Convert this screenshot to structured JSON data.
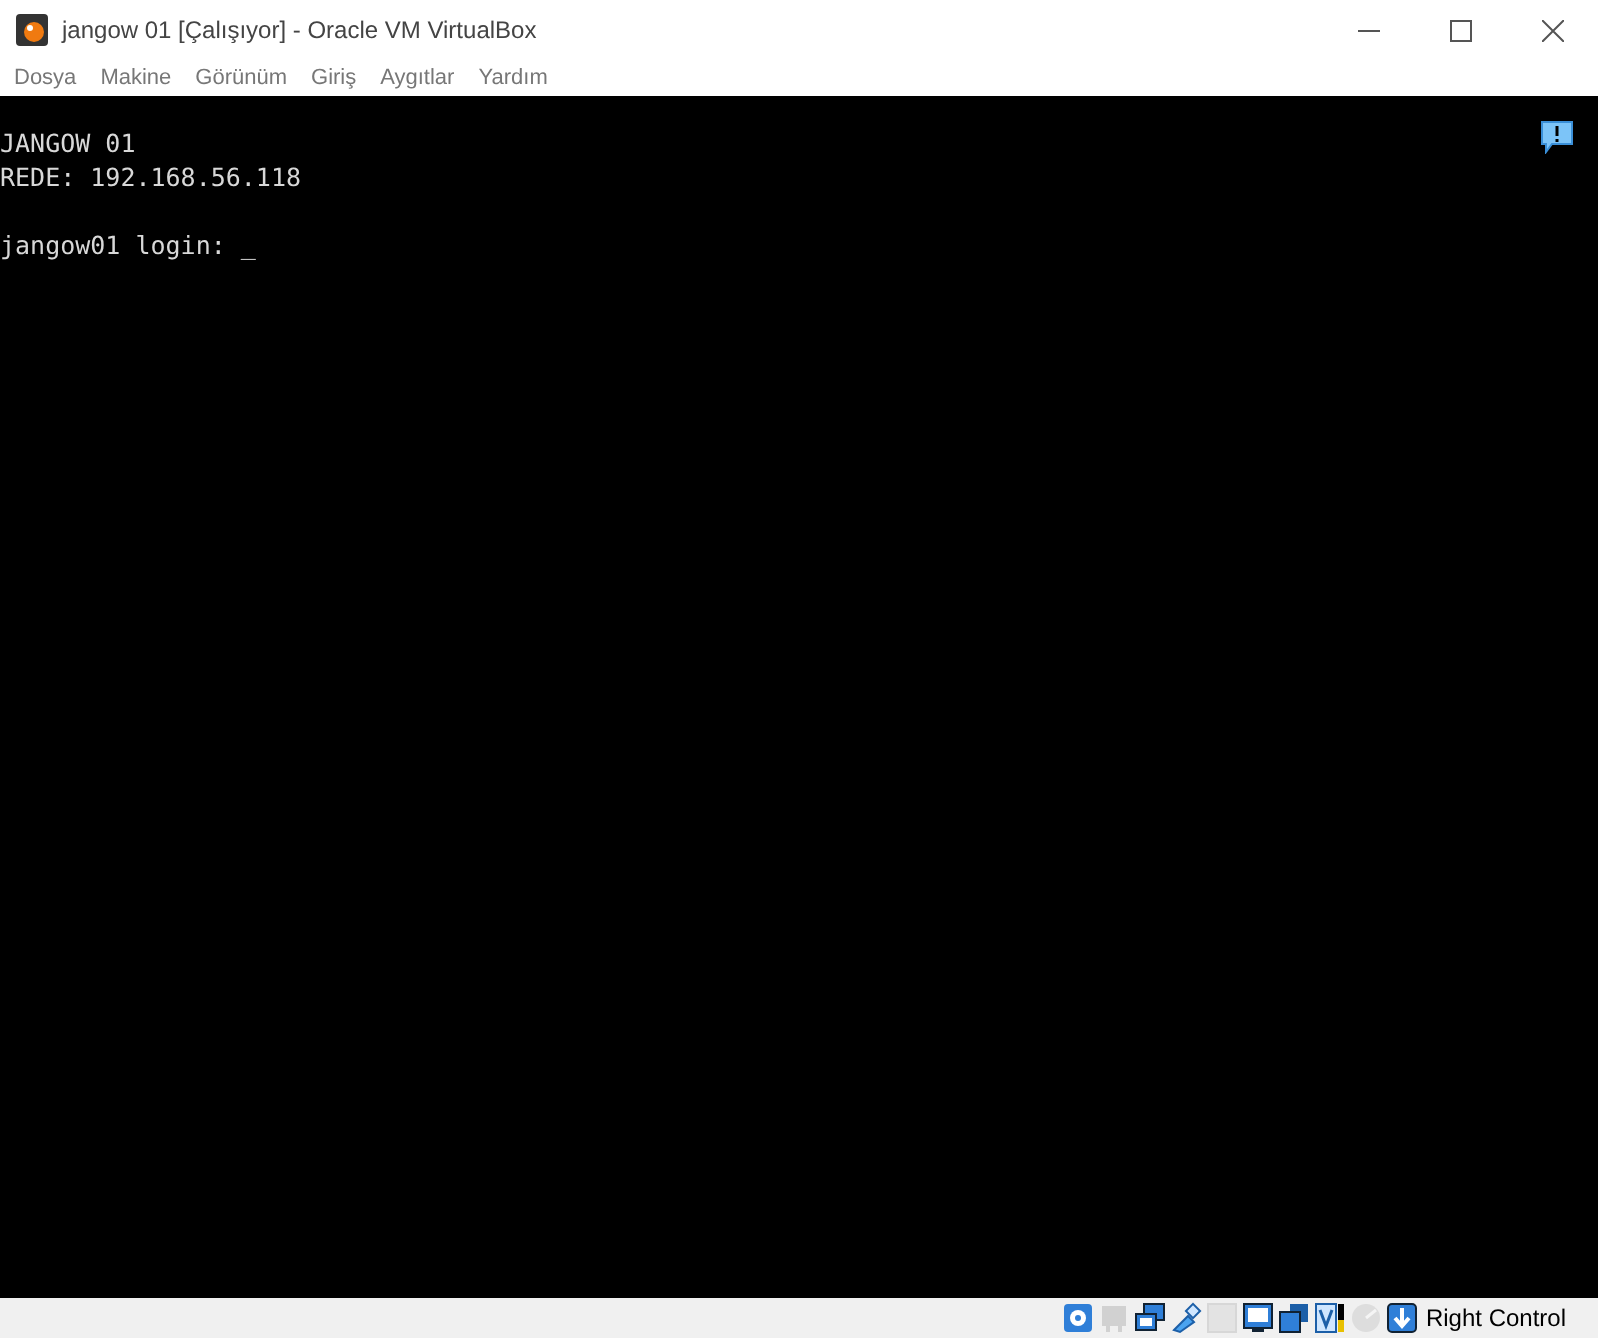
{
  "window": {
    "title": "jangow 01 [Çalışıyor] - Oracle VM VirtualBox"
  },
  "menu": [
    "Dosya",
    "Makine",
    "Görünüm",
    "Giriş",
    "Aygıtlar",
    "Yardım"
  ],
  "console": {
    "blocks": [
      [
        "JANGOW 01",
        "REDE: 192.168.56.118"
      ],
      [
        "jangow01 login: _"
      ]
    ]
  },
  "status_bar": {
    "icons": [
      {
        "kind": "disk",
        "disabled": false
      },
      {
        "kind": "network",
        "disabled": true
      },
      {
        "kind": "shared",
        "disabled": false
      },
      {
        "kind": "usb",
        "disabled": false
      },
      {
        "kind": "optical",
        "disabled": true
      },
      {
        "kind": "display",
        "disabled": false
      },
      {
        "kind": "folders",
        "disabled": false
      },
      {
        "kind": "capture",
        "disabled": false
      },
      {
        "kind": "mouse",
        "disabled": true
      },
      {
        "kind": "hostkey",
        "disabled": false
      }
    ],
    "host_key": "Right Control"
  }
}
